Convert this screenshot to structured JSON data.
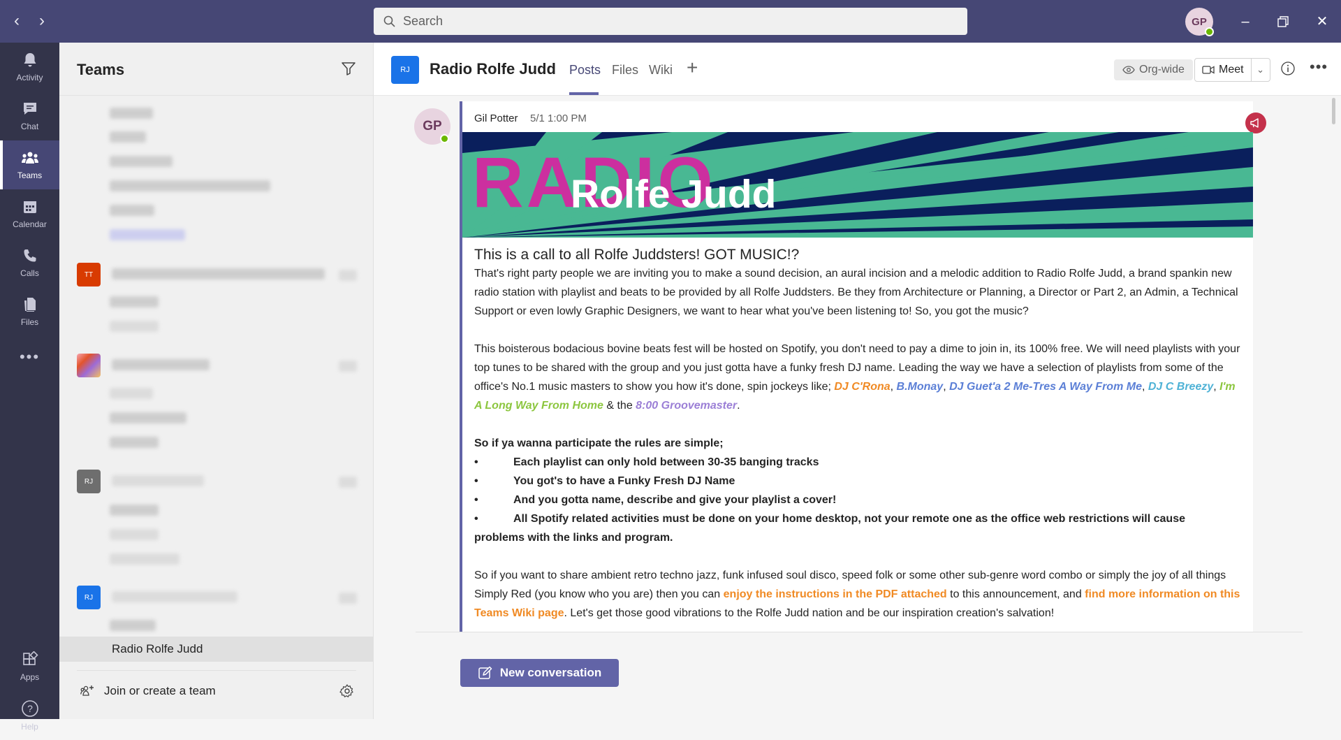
{
  "search": {
    "placeholder": "Search"
  },
  "user": {
    "initials": "GP"
  },
  "rail": [
    {
      "label": "Activity",
      "icon": "bell-icon"
    },
    {
      "label": "Chat",
      "icon": "chat-icon"
    },
    {
      "label": "Teams",
      "icon": "teams-icon"
    },
    {
      "label": "Calendar",
      "icon": "calendar-icon"
    },
    {
      "label": "Calls",
      "icon": "phone-icon"
    },
    {
      "label": "Files",
      "icon": "files-icon"
    },
    {
      "label": "Apps",
      "icon": "apps-icon"
    },
    {
      "label": "Help",
      "icon": "help-icon"
    }
  ],
  "teams_panel": {
    "title": "Teams",
    "tiles": [
      "TT",
      "RJ",
      "RJ"
    ],
    "selected_channel": "Radio Rolfe Judd",
    "join_label": "Join or create a team"
  },
  "channel": {
    "tile": "RJ",
    "name": "Radio Rolfe Judd",
    "tabs": [
      "Posts",
      "Files",
      "Wiki"
    ],
    "org_wide": "Org-wide",
    "meet": "Meet"
  },
  "post": {
    "avatar": "GP",
    "author": "Gil Potter",
    "time": "5/1 1:00 PM",
    "banner": {
      "line1": "RADIO",
      "line2": "Rolfe Judd"
    },
    "heading": "This is a call to all Rolfe Juddsters! GOT MUSIC!?",
    "p1": "That's right party people we are inviting you to make a sound decision, an aural incision and a melodic addition to Radio Rolfe Judd, a brand spankin new radio station with playlist and beats to be provided by all Rolfe Juddsters. Be they from Architecture or Planning, a Director or Part 2, an Admin, a Technical Support or even lowly Graphic Designers, we want to hear what you've been listening to! So, you got the music?",
    "p2_text": "This boisterous bodacious bovine beats fest will be hosted on Spotify, you don't need to pay a dime to join in, its 100% free. We will need playlists with your top tunes to be shared with the group and you just gotta have a funky fresh DJ name. Leading the way we have a selection of playlists from some of the office's No.1 music masters to show you how it's done, spin jockeys like;",
    "dj1": "DJ C'Rona",
    "dj2": "B.Monay",
    "dj3": "DJ Guet'a 2 Me-Tres A Way From Me",
    "dj4": "DJ C Breezy",
    "dj5": "I'm A Long Way From Home",
    "amp": "& the",
    "dj6": "8:00 Groovemaster",
    "rules_intro": "So if ya wanna participate the rules are simple;",
    "bullets": [
      "Each playlist can only hold between 30-35 banging tracks",
      "You got's to have a Funky Fresh DJ Name",
      "And you gotta name, describe and give your playlist a cover!",
      "All Spotify related activities must be done on your home desktop, not your remote one as the office web restrictions will cause"
    ],
    "bullet4_cont": "problems with the links and program.",
    "p4a": "So if you want to share ambient retro techno jazz, funk infused soul disco, speed folk or some other sub-genre word combo or simply the joy of all things Simply Red (you know who you are) then you can",
    "link1": "enjoy the instructions in the PDF attached",
    "p4b": "to this announcement, and",
    "link2": "find more information on this Teams Wiki page",
    "p4c": ". Let's get those good vibrations to the Rolfe Judd nation and be our inspiration creation's salvation!"
  },
  "new_conversation": "New conversation",
  "colors": {
    "titlebar": "#464775",
    "rail": "#33344a",
    "accent": "#6264a7",
    "link_orange": "#f08a24"
  }
}
